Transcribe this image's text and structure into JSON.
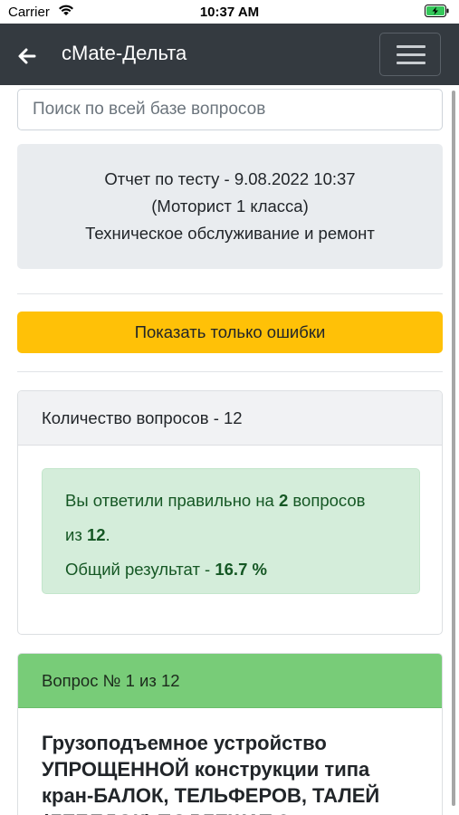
{
  "status_bar": {
    "carrier": "Carrier",
    "time": "10:37 AM"
  },
  "navbar": {
    "title": "cMate-Дельта",
    "back_icon": "arrow-left-icon",
    "menu_icon": "hamburger-menu-icon"
  },
  "search": {
    "placeholder": "Поиск по всей базе вопросов"
  },
  "report": {
    "line1": "Отчет по тесту - 9.08.2022 10:37",
    "line2": "(Моторист 1 класса)",
    "line3": "Техническое обслуживание и ремонт"
  },
  "errors_button": {
    "label": "Показать только ошибки"
  },
  "stats": {
    "header": "Количество вопросов - 12",
    "answered_prefix": "Вы ответили правильно на",
    "correct_count": "2",
    "answered_mid": "вопросов",
    "from_word": "из",
    "total": "12",
    "period": ".",
    "result_label": "Общий результат -",
    "result_value": "16.7 %"
  },
  "question": {
    "header": "Вопрос № 1 из 12",
    "text": "Грузоподъемное устройство УПРОЩЕННОЙ конструкции типа кран-БАЛОК, ТЕЛЬФЕРОВ, ТАЛЕЙ (ЛЕБЕДОК) ПОДЛЕЖАТ ?"
  },
  "colors": {
    "navbar_bg": "#343a40",
    "warning": "#ffc107",
    "success_bg": "#d4edda",
    "success_text": "#155724",
    "question_header_bg": "#78cc78"
  }
}
